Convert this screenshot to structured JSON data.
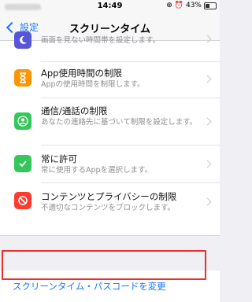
{
  "status_bar": {
    "time": "14:49",
    "battery": "43%"
  },
  "nav": {
    "back_label": "設定",
    "title": "スクリーンタイム"
  },
  "rows": [
    {
      "subtitle": "画面を見ない時間帯を設定します。",
      "icon": "moon-icon",
      "color": "#5856d6"
    },
    {
      "title": "App使用時間の制限",
      "subtitle": "Appの使用時間を制限します。",
      "icon": "hourglass-icon",
      "color": "#ff9500"
    },
    {
      "title": "通信/通話の制限",
      "subtitle": "あなたの連絡先に基づいて制限を設定します。",
      "icon": "person-icon",
      "color": "#34c759"
    },
    {
      "title": "常に許可",
      "subtitle": "常に使用するAppを選択します。",
      "icon": "checkmark-icon",
      "color": "#34c759"
    },
    {
      "title": "コンテンツとプライバシーの制限",
      "subtitle": "不適切なコンテンツをブロックします。",
      "icon": "prohibited-icon",
      "color": "#ff3b30"
    }
  ],
  "passcode": {
    "label": "スクリーンタイム・パスコードを変更"
  }
}
